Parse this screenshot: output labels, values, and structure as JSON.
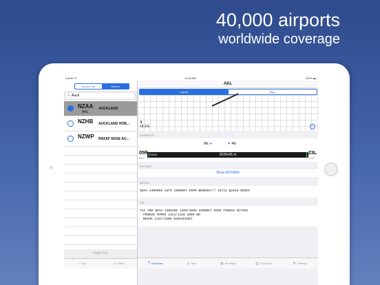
{
  "headline": {
    "line1": "40,000 airports",
    "line2": "worldwide coverage"
  },
  "status": {
    "carrier": "Carrier ✦",
    "time": "11:45 AM",
    "battery": "100% ▬"
  },
  "left": {
    "segments": [
      "Around me",
      "Search"
    ],
    "search_value": "Auck",
    "airports": [
      {
        "icao": "NZAA",
        "iata": "AKL",
        "name": "AUCKLAND"
      },
      {
        "icao": "NZHB",
        "iata": "",
        "name": "AUCKLAND HOB..."
      },
      {
        "icao": "NZWP",
        "iata": "",
        "name": "RNZAF BASE AU..."
      }
    ],
    "flight_clip": "Flight Clip",
    "tabs": [
      "City",
      "Charts"
    ]
  },
  "right": {
    "title": "AKL",
    "segments": [
      "Layout",
      "Map"
    ],
    "magvar": "19.3 E",
    "runways_label": "RUNWAYS",
    "wind_left": "8kt",
    "wind_right": "4kt",
    "rw_left_id": "05R",
    "rw_left_hdg": "052°",
    "rw_right_id": "23L",
    "rw_right_hdg": "232°",
    "rw_tdz": "290m",
    "rw_length": "3535x45 m",
    "notams_label": "NOTAMS",
    "notams_button": "Show NOTAMs",
    "metar_label": "METAR",
    "metar": "NZAA 140900Z AUTO 28009KT 9999 BKN038/// 16/14 Q1018 NOSIG",
    "taf_label": "TAF",
    "taf1": "TAF AMD NZAA 140929Z 1409/1506 32008KT 9999 FEW018 SCT035",
    "taf2": "PROB30 TEMPO 1414/1420 2000 BR",
    "taf3": "BECMG 1422/1500 02015G25KT",
    "tabs": [
      "Database",
      "Map",
      "Briefings",
      "Dictionary",
      "Settings"
    ]
  }
}
